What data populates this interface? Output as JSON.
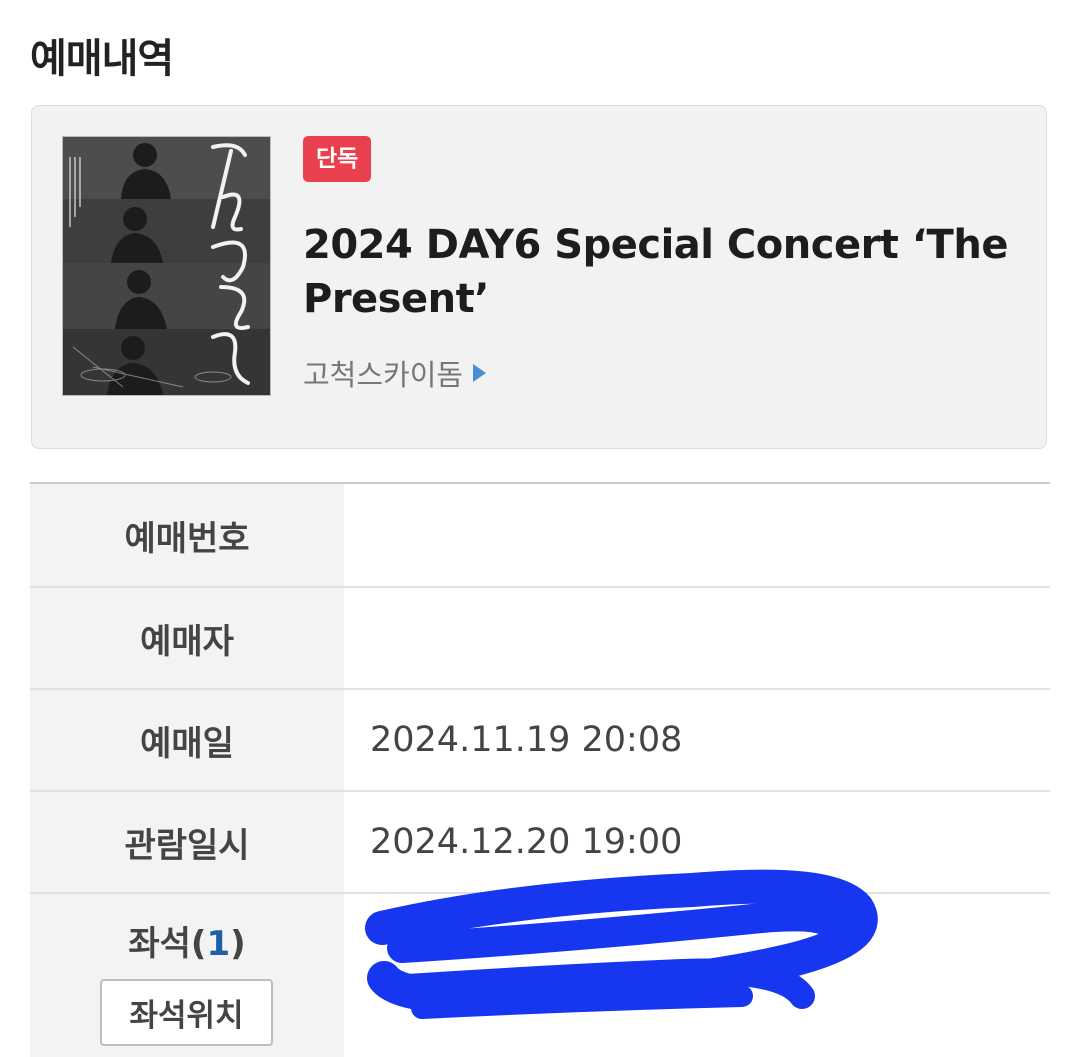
{
  "page": {
    "title": "예매내역"
  },
  "event": {
    "badge": "단독",
    "title": "2024 DAY6 Special Concert ‘The Present’",
    "venue": "고척스카이돔",
    "poster_title": "The Present"
  },
  "details": {
    "booking_number": {
      "label": "예매번호",
      "value": ""
    },
    "booker": {
      "label": "예매자",
      "value": ""
    },
    "booking_date": {
      "label": "예매일",
      "value": "2024.11.19 20:08"
    },
    "viewing_datetime": {
      "label": "관람일시",
      "value": "2024.12.20 19:00"
    },
    "seat": {
      "label": "좌석",
      "count_open": "(",
      "count": "1",
      "count_close": ")",
      "button_label": "좌석위치"
    }
  },
  "colors": {
    "badge": "#e8404e",
    "venue_arrow": "#4a8fd4",
    "seat_count": "#1f5fa8",
    "redaction_scribble": "#1736f0"
  },
  "icons": {
    "venue_arrow": "triangle-right-icon"
  }
}
